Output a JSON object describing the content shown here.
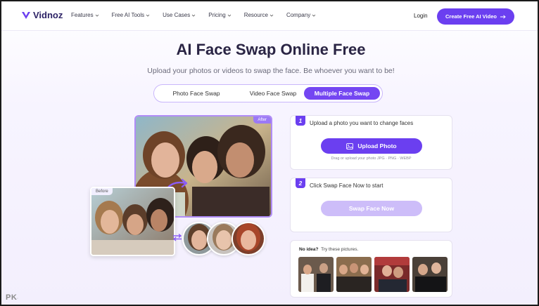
{
  "brand": {
    "name": "Vidnoz",
    "accent": "#6b3ff0"
  },
  "nav": {
    "items": [
      {
        "label": "Features"
      },
      {
        "label": "Free AI Tools"
      },
      {
        "label": "Use Cases"
      },
      {
        "label": "Pricing"
      },
      {
        "label": "Resource"
      },
      {
        "label": "Company"
      }
    ],
    "login": "Login",
    "cta": "Create Free AI Video",
    "cta_icon": "arrow-right-icon"
  },
  "hero": {
    "title": "AI Face Swap Online Free",
    "subtitle": "Upload your photos or videos to swap the face. Be whoever you want to be!"
  },
  "tabs": [
    {
      "label": "Photo Face Swap",
      "active": false
    },
    {
      "label": "Video Face Swap",
      "active": false
    },
    {
      "label": "Multiple Face Swap",
      "active": true
    }
  ],
  "preview": {
    "after_badge": "After",
    "before_badge": "Before"
  },
  "step1": {
    "number": "1",
    "text": "Upload a photo you want to change faces",
    "button": "Upload Photo",
    "hint": "Drag or upload your photo JPG · PNG · WEBP"
  },
  "step2": {
    "number": "2",
    "text": "Click Swap Face Now to start",
    "button": "Swap Face Now"
  },
  "samples": {
    "label_bold": "No idea?",
    "label": "Try these pictures."
  },
  "watermark": {
    "text": "PK",
    "sub": "·"
  }
}
